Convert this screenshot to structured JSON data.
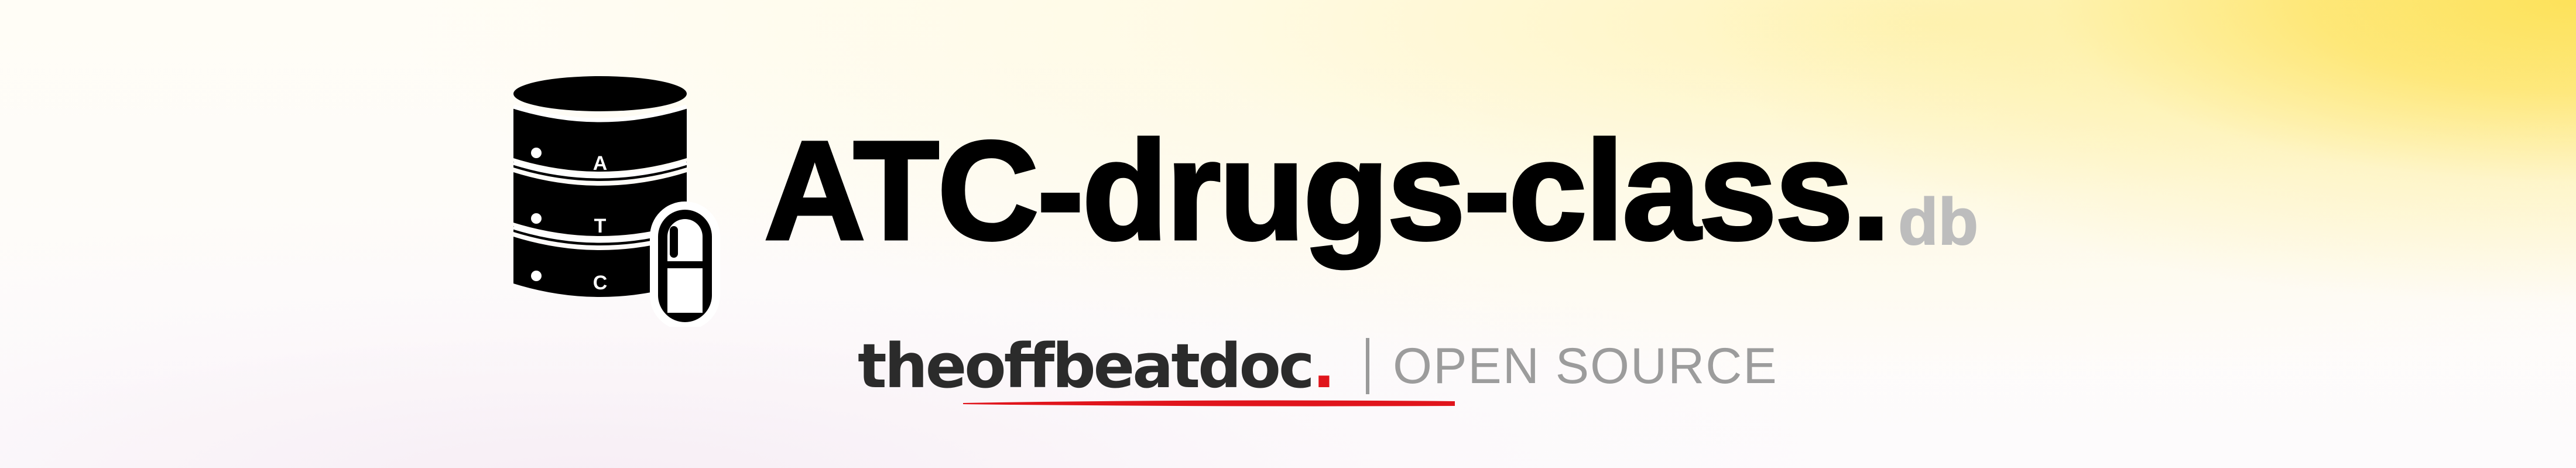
{
  "logo": {
    "icon": "database-pill-icon",
    "letters": [
      "A",
      "T",
      "C"
    ]
  },
  "title": {
    "main": "ATC-drugs-class.",
    "suffix": "db"
  },
  "brand": {
    "name": "theoffbeatdoc",
    "dot": "."
  },
  "tagline": "OPEN SOURCE",
  "colors": {
    "title": "#000000",
    "suffix": "#bdbdbd",
    "brand_text": "#2b2b2b",
    "brand_accent": "#e0151c",
    "tagline": "#9c9c9c",
    "background_glow": "#fde25a"
  }
}
